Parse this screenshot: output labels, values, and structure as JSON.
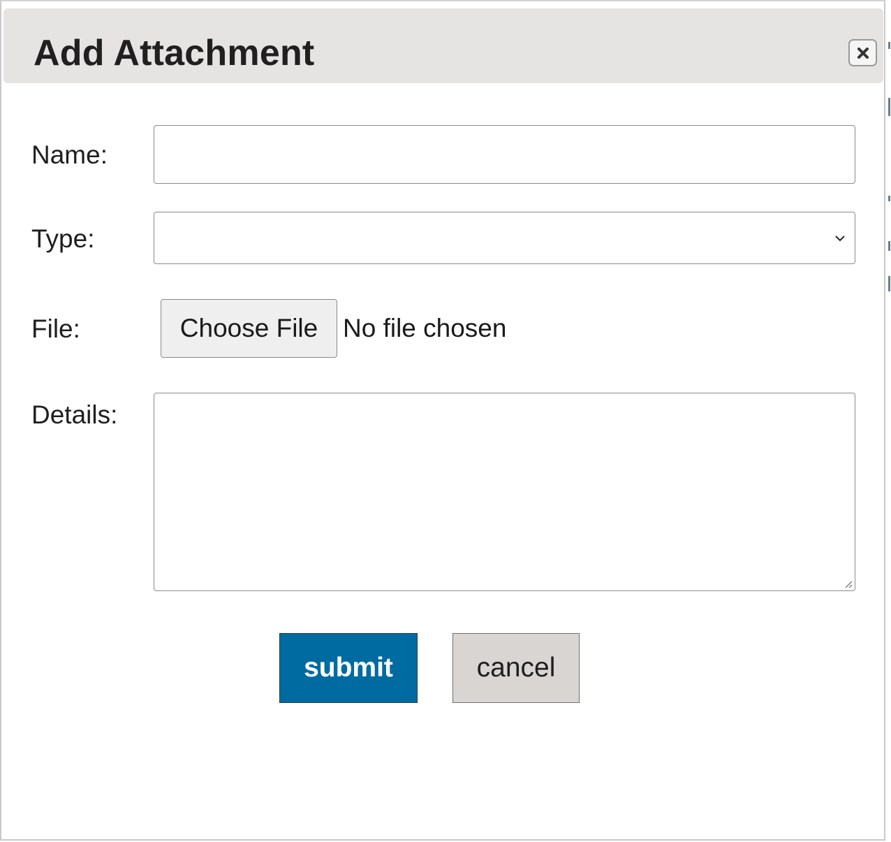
{
  "dialog": {
    "title": "Add Attachment",
    "close_icon": "close-icon"
  },
  "form": {
    "name_label": "Name:",
    "name_value": "",
    "type_label": "Type:",
    "type_selected": "",
    "type_icon": "chevron-down-icon",
    "file_label": "File:",
    "file_button_label": "Choose File",
    "file_status": "No file chosen",
    "details_label": "Details:",
    "details_value": ""
  },
  "actions": {
    "submit_label": "submit",
    "cancel_label": "cancel"
  },
  "colors": {
    "titlebar_bg": "#e5e4e2",
    "submit_bg": "#006ba1",
    "cancel_bg": "#d9d5d3"
  }
}
